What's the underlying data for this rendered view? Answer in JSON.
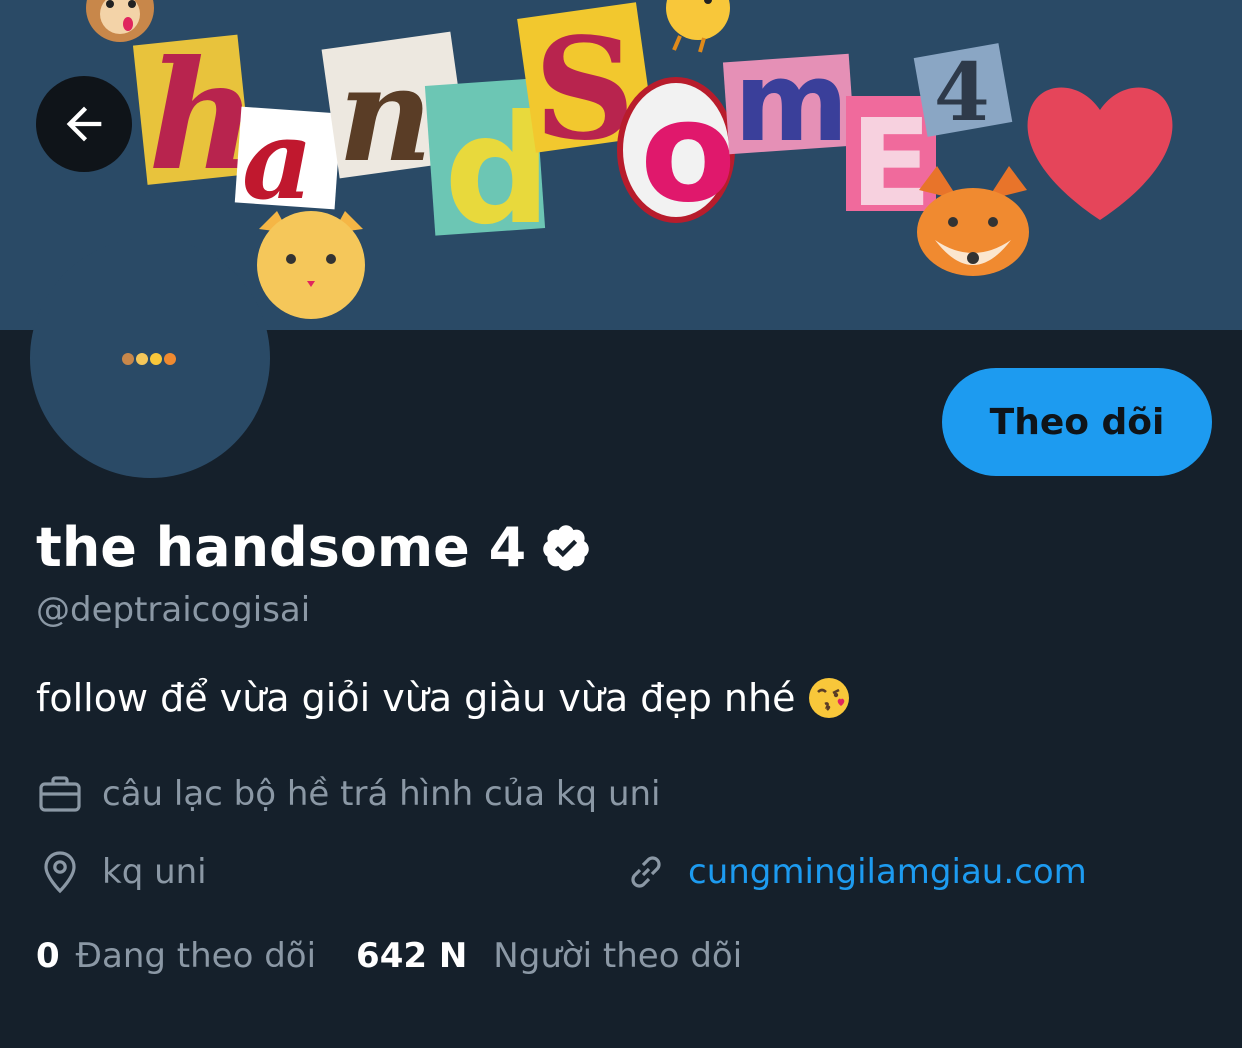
{
  "header": {
    "back_icon": "arrow-left-icon",
    "banner_letters": [
      "h",
      "a",
      "n",
      "d",
      "S",
      "o",
      "m",
      "E",
      "4"
    ]
  },
  "avatar": {
    "emoji_strip": "dog-cat-chick-fox"
  },
  "follow_button": {
    "label": "Theo dõi"
  },
  "profile": {
    "display_name": "the handsome 4",
    "verified_icon": "verified-badge-icon",
    "handle": "@deptraicogisai",
    "bio": "follow để vừa giỏi vừa giàu vừa đẹp nhé",
    "bio_emoji": "face-blowing-kiss"
  },
  "meta": {
    "work_icon": "briefcase-icon",
    "work": "câu lạc bộ hề trá hình của kq uni",
    "location_icon": "location-pin-icon",
    "location": "kq uni",
    "link_icon": "link-icon",
    "website": "cungmingilamgiau.com"
  },
  "stats": {
    "following_count": "0",
    "following_label": "Đang theo dõi",
    "followers_count": "642 N",
    "followers_label": "Người theo dõi"
  },
  "colors": {
    "background": "#15202b",
    "banner": "#2a4a66",
    "accent": "#1d9bf0",
    "muted": "#8b98a5"
  }
}
